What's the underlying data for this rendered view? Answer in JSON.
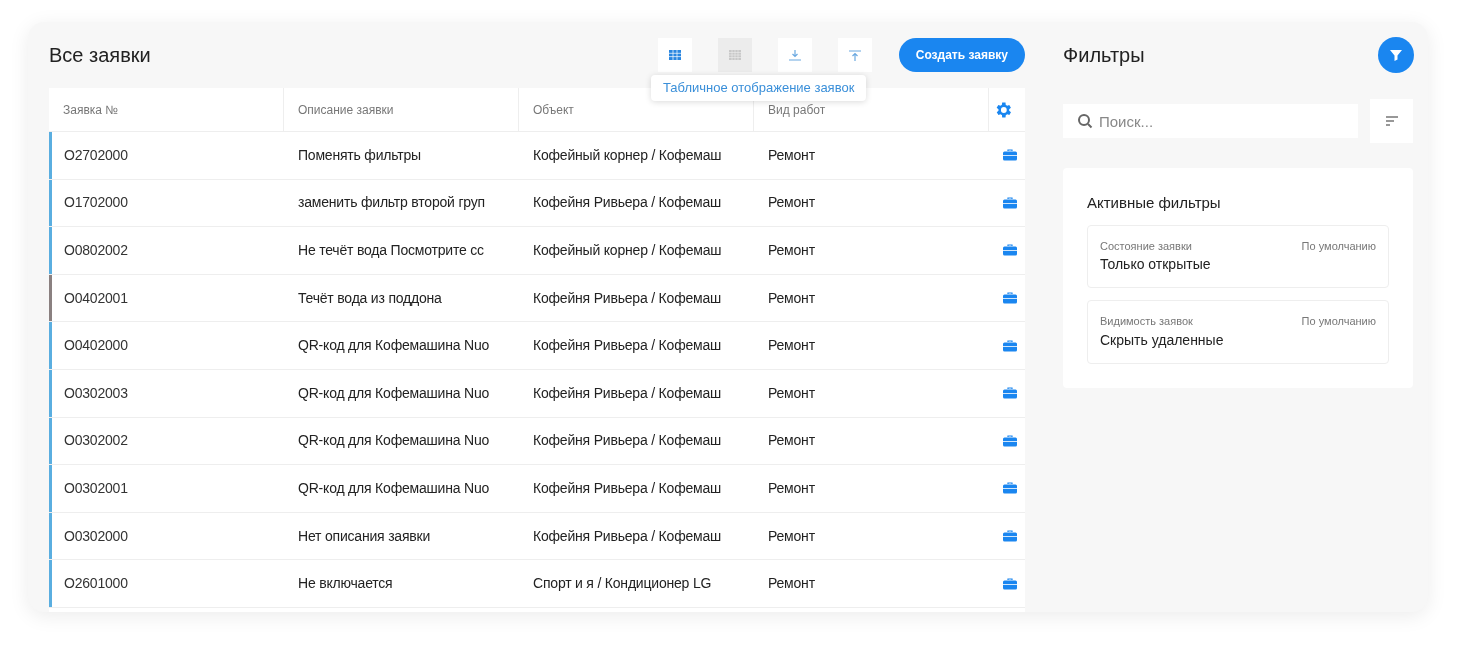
{
  "title": "Все заявки",
  "view_buttons": [
    {
      "kind": "table",
      "selected": true
    },
    {
      "kind": "grid",
      "selected": false
    },
    {
      "kind": "download",
      "selected": false
    },
    {
      "kind": "upload",
      "selected": false
    }
  ],
  "create_button": "Создать заявку",
  "tooltip": "Табличное отображение заявок",
  "table": {
    "columns": [
      "Заявка №",
      "Описание заявки",
      "Объект",
      "Вид работ"
    ],
    "rows": [
      {
        "number": "O2702000",
        "description": "Поменять фильтры",
        "object": "Кофейный корнер / Кофемаш",
        "work": "Ремонт",
        "color": "#5aaee0"
      },
      {
        "number": "O1702000",
        "description": "заменить фильтр второй груп",
        "object": "Кофейня Ривьера / Кофемаш",
        "work": "Ремонт",
        "color": "#5aaee0"
      },
      {
        "number": "O0802002",
        "description": "Не течёт вода Посмотрите сс",
        "object": "Кофейный корнер / Кофемаш",
        "work": "Ремонт",
        "color": "#5aaee0"
      },
      {
        "number": "O0402001",
        "description": "Течёт вода из поддона",
        "object": "Кофейня Ривьера / Кофемаш",
        "work": "Ремонт",
        "color": "#8a8080"
      },
      {
        "number": "O0402000",
        "description": "QR-код для Кофемашина Nuo",
        "object": "Кофейня Ривьера / Кофемаш",
        "work": "Ремонт",
        "color": "#5aaee0"
      },
      {
        "number": "O0302003",
        "description": "QR-код для Кофемашина Nuo",
        "object": "Кофейня Ривьера / Кофемаш",
        "work": "Ремонт",
        "color": "#5aaee0"
      },
      {
        "number": "O0302002",
        "description": "QR-код для Кофемашина Nuo",
        "object": "Кофейня Ривьера / Кофемаш",
        "work": "Ремонт",
        "color": "#5aaee0"
      },
      {
        "number": "O0302001",
        "description": "QR-код для Кофемашина Nuo",
        "object": "Кофейня Ривьера / Кофемаш",
        "work": "Ремонт",
        "color": "#5aaee0"
      },
      {
        "number": "O0302000",
        "description": "Нет описания заявки",
        "object": "Кофейня Ривьера / Кофемаш",
        "work": "Ремонт",
        "color": "#5aaee0"
      },
      {
        "number": "O2601000",
        "description": "Не включается",
        "object": "Спорт и я / Кондиционер LG",
        "work": "Ремонт",
        "color": "#5aaee0"
      }
    ]
  },
  "filters": {
    "title": "Фильтры",
    "search": {
      "placeholder": "Поиск..."
    },
    "active_title": "Активные фильтры",
    "items": [
      {
        "label": "Состояние заявки",
        "default": "По умолчанию",
        "value": "Только открытые"
      },
      {
        "label": "Видимость заявок",
        "default": "По умолчанию",
        "value": "Скрыть удаленные"
      }
    ]
  }
}
